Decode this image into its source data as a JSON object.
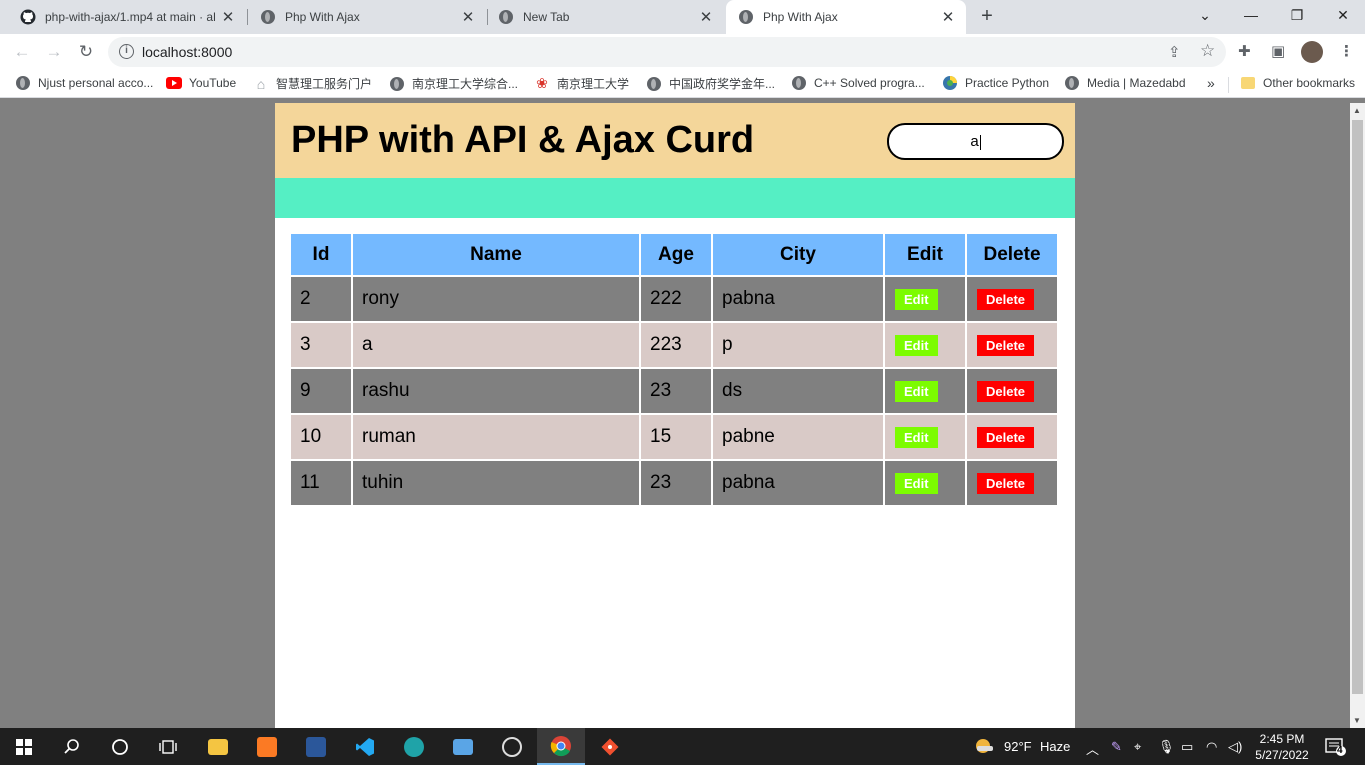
{
  "browser": {
    "tabs": [
      {
        "title": "php-with-ajax/1.mp4 at main · al",
        "icon": "github-icon",
        "active": false
      },
      {
        "title": "Php With Ajax",
        "icon": "globe-icon",
        "active": false
      },
      {
        "title": "New Tab",
        "icon": "chrome-icon",
        "active": false
      },
      {
        "title": "Php With Ajax",
        "icon": "globe-icon",
        "active": true
      }
    ],
    "url": "localhost:8000",
    "bookmarks": [
      {
        "label": "Njust personal acco..."
      },
      {
        "label": "YouTube"
      },
      {
        "label": "智慧理工服务门户"
      },
      {
        "label": "南京理工大学综合..."
      },
      {
        "label": "南京理工大学"
      },
      {
        "label": "中国政府奖学金年..."
      },
      {
        "label": "C++ Solved progra..."
      },
      {
        "label": "Practice Python"
      },
      {
        "label": "Media | Mazedabd"
      }
    ],
    "more_bookmarks": "»",
    "other_bookmarks": "Other bookmarks"
  },
  "page": {
    "title": "PHP with API & Ajax Curd",
    "search_value": "a",
    "table": {
      "headers": [
        "Id",
        "Name",
        "Age",
        "City",
        "Edit",
        "Delete"
      ],
      "rows": [
        {
          "id": "2",
          "name": "rony",
          "age": "222",
          "city": "pabna"
        },
        {
          "id": "3",
          "name": "a",
          "age": "223",
          "city": "p"
        },
        {
          "id": "9",
          "name": "rashu",
          "age": "23",
          "city": "ds"
        },
        {
          "id": "10",
          "name": "ruman",
          "age": "15",
          "city": "pabne"
        },
        {
          "id": "11",
          "name": "tuhin",
          "age": "23",
          "city": "pabna"
        }
      ],
      "edit_label": "Edit",
      "delete_label": "Delete"
    }
  },
  "taskbar": {
    "weather_temp": "92°F",
    "weather_text": "Haze",
    "time": "2:45 PM",
    "date": "5/27/2022",
    "notifications": "4"
  },
  "colors": {
    "header_bg": "#f4d69a",
    "teal_bar": "#55efc4",
    "table_header": "#74b9ff",
    "row_dark": "#808080",
    "row_light": "#d9cac7",
    "edit_btn": "#7cfc00",
    "delete_btn": "#ff0000"
  }
}
